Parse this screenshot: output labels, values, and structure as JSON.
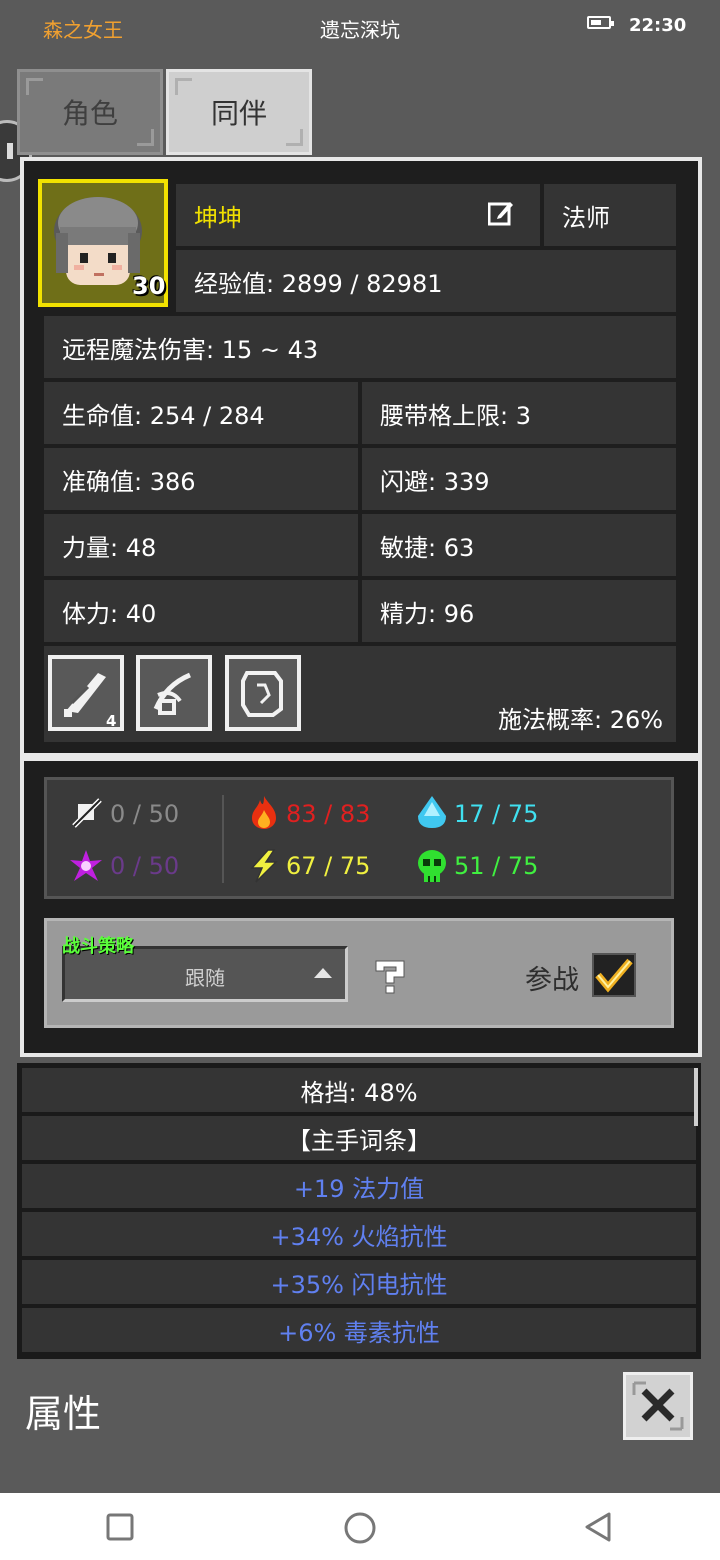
{
  "status_bar": {
    "title_left": "森之女王",
    "title_center": "遗忘深坑",
    "time": "22:30"
  },
  "tabs": [
    {
      "label": "角色"
    },
    {
      "label": "同伴"
    }
  ],
  "character": {
    "name": "坤坤",
    "class": "法师",
    "level": "30",
    "exp": "经验值: 2899 / 82981",
    "ranged_damage": "远程魔法伤害: 15 ~ 43",
    "stats": [
      {
        "left": "生命值: 254 / 284",
        "right": "腰带格上限: 3"
      },
      {
        "left": "准确值: 386",
        "right": "闪避: 339"
      },
      {
        "left": "力量: 48",
        "right": "敏捷: 63"
      },
      {
        "left": "体力: 40",
        "right": "精力: 96"
      }
    ],
    "skill_count": "4",
    "cast_chance": "施法概率: 26%"
  },
  "resistances": {
    "physical": "0 / 50",
    "magic": "0 / 50",
    "fire": "83 / 83",
    "lightning": "67 / 75",
    "cold": "17 / 75",
    "poison": "51 / 75"
  },
  "colors": {
    "physical": "#8a8a8a",
    "magic": "#6a3a8a",
    "fire": "#e02020",
    "lightning": "#f0f040",
    "cold": "#40e0f0",
    "poison": "#40f040",
    "affix": "#6080f0"
  },
  "tactics": {
    "label": "战斗策略",
    "value": "跟随",
    "join_label": "参战"
  },
  "item_list": [
    {
      "text": "格挡: 48%"
    },
    {
      "text": "【主手词条】"
    },
    {
      "text": "+19 法力值"
    },
    {
      "text": "+34% 火焰抗性"
    },
    {
      "text": "+35% 闪电抗性"
    },
    {
      "text": "+6% 毒素抗性"
    }
  ],
  "footer": {
    "title": "属性"
  }
}
